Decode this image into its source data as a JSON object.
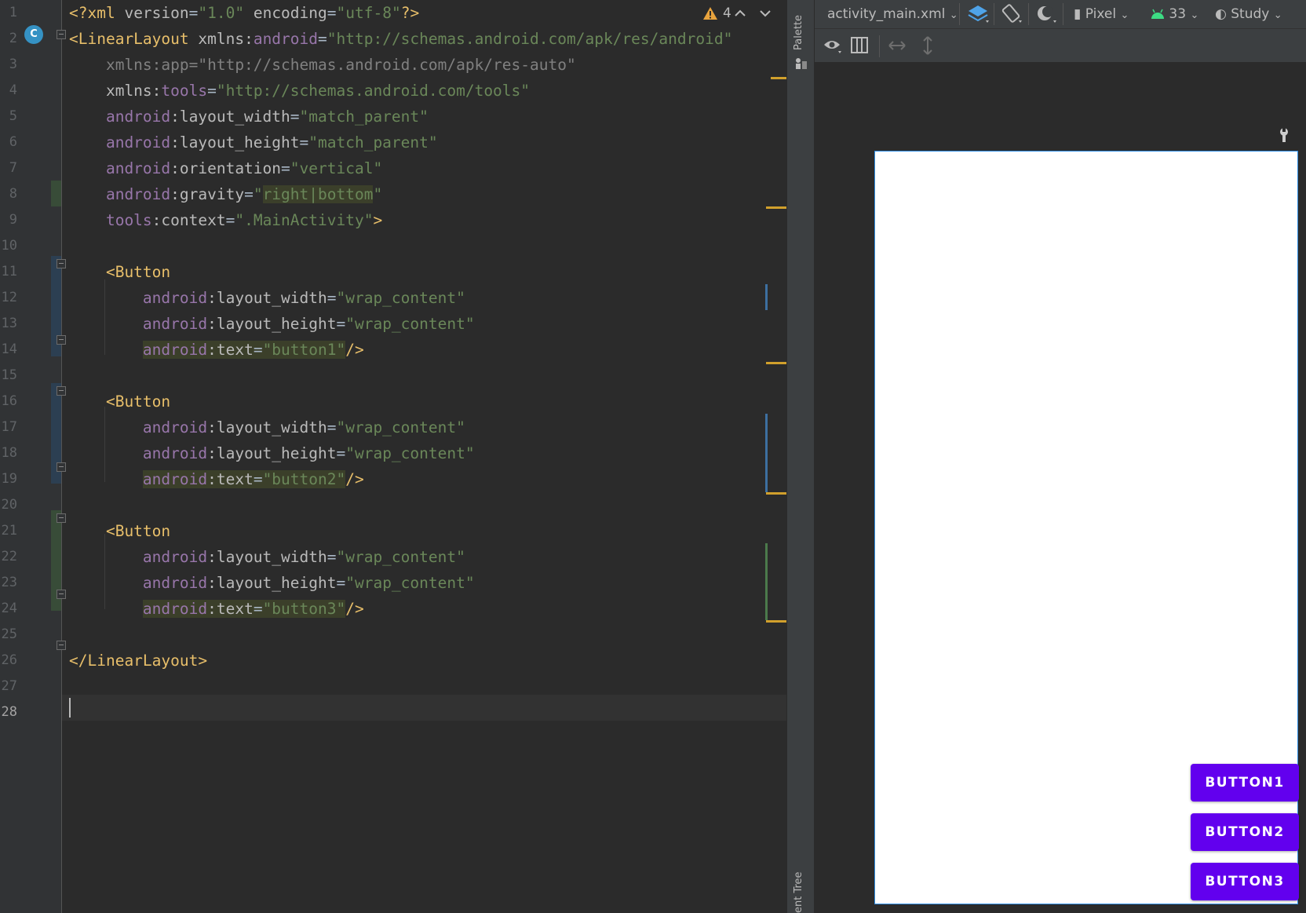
{
  "editor": {
    "line_numbers": [
      "1",
      "2",
      "3",
      "4",
      "5",
      "6",
      "7",
      "8",
      "9",
      "10",
      "11",
      "12",
      "13",
      "14",
      "15",
      "16",
      "17",
      "18",
      "19",
      "20",
      "21",
      "22",
      "23",
      "24",
      "25",
      "26",
      "27",
      "28"
    ],
    "class_badge": "C",
    "warning_count": "4",
    "lines": [
      [
        {
          "t": "<?xml ",
          "c": "c-yel"
        },
        {
          "t": "version",
          "c": "c-attr"
        },
        {
          "t": "=",
          "c": "c-pun"
        },
        {
          "t": "\"1.0\"",
          "c": "c-val"
        },
        {
          "t": " encoding",
          "c": "c-attr"
        },
        {
          "t": "=",
          "c": "c-pun"
        },
        {
          "t": "\"utf-8\"",
          "c": "c-val"
        },
        {
          "t": "?>",
          "c": "c-yel"
        }
      ],
      [
        {
          "t": "<LinearLayout ",
          "c": "c-tag"
        },
        {
          "t": "xmlns:",
          "c": "c-attr"
        },
        {
          "t": "android",
          "c": "c-ns"
        },
        {
          "t": "=",
          "c": "c-pun"
        },
        {
          "t": "\"http://schemas.android.com/apk/res/android\"",
          "c": "c-val"
        }
      ],
      [
        {
          "t": "    xmlns:app=\"http://schemas.android.com/apk/res-auto\"",
          "c": "c-gray"
        }
      ],
      [
        {
          "t": "    xmlns:",
          "c": "c-attr"
        },
        {
          "t": "tools",
          "c": "c-ns"
        },
        {
          "t": "=",
          "c": "c-pun"
        },
        {
          "t": "\"http://schemas.android.com/tools\"",
          "c": "c-val"
        }
      ],
      [
        {
          "t": "    android",
          "c": "c-ns"
        },
        {
          "t": ":layout_width",
          "c": "c-attr"
        },
        {
          "t": "=",
          "c": "c-pun"
        },
        {
          "t": "\"match_parent\"",
          "c": "c-val"
        }
      ],
      [
        {
          "t": "    android",
          "c": "c-ns"
        },
        {
          "t": ":layout_height",
          "c": "c-attr"
        },
        {
          "t": "=",
          "c": "c-pun"
        },
        {
          "t": "\"match_parent\"",
          "c": "c-val"
        }
      ],
      [
        {
          "t": "    android",
          "c": "c-ns"
        },
        {
          "t": ":orientation",
          "c": "c-attr"
        },
        {
          "t": "=",
          "c": "c-pun"
        },
        {
          "t": "\"vertical\"",
          "c": "c-val"
        }
      ],
      [
        {
          "t": "    android",
          "c": "c-ns"
        },
        {
          "t": ":gravity",
          "c": "c-attr"
        },
        {
          "t": "=",
          "c": "c-pun"
        },
        {
          "t": "\"",
          "c": "c-val"
        },
        {
          "t": "right|bottom",
          "c": "c-val hl"
        },
        {
          "t": "\"",
          "c": "c-val"
        }
      ],
      [
        {
          "t": "    tools",
          "c": "c-ns"
        },
        {
          "t": ":context",
          "c": "c-attr"
        },
        {
          "t": "=",
          "c": "c-pun"
        },
        {
          "t": "\".MainActivity\"",
          "c": "c-val"
        },
        {
          "t": ">",
          "c": "c-tag"
        }
      ],
      [],
      [
        {
          "t": "    <Button",
          "c": "c-tag"
        }
      ],
      [
        {
          "t": "        android",
          "c": "c-ns"
        },
        {
          "t": ":layout_width",
          "c": "c-attr"
        },
        {
          "t": "=",
          "c": "c-pun"
        },
        {
          "t": "\"wrap_content\"",
          "c": "c-val"
        }
      ],
      [
        {
          "t": "        android",
          "c": "c-ns"
        },
        {
          "t": ":layout_height",
          "c": "c-attr"
        },
        {
          "t": "=",
          "c": "c-pun"
        },
        {
          "t": "\"wrap_content\"",
          "c": "c-val"
        }
      ],
      [
        {
          "t": "        ",
          "c": "c-pun"
        },
        {
          "t": "android",
          "c": "c-ns hl"
        },
        {
          "t": ":text",
          "c": "c-attr hl"
        },
        {
          "t": "=",
          "c": "c-pun hl"
        },
        {
          "t": "\"button1\"",
          "c": "c-val hl"
        },
        {
          "t": "/>",
          "c": "c-tag"
        }
      ],
      [],
      [
        {
          "t": "    <Button",
          "c": "c-tag"
        }
      ],
      [
        {
          "t": "        android",
          "c": "c-ns"
        },
        {
          "t": ":layout_width",
          "c": "c-attr"
        },
        {
          "t": "=",
          "c": "c-pun"
        },
        {
          "t": "\"wrap_content\"",
          "c": "c-val"
        }
      ],
      [
        {
          "t": "        android",
          "c": "c-ns"
        },
        {
          "t": ":layout_height",
          "c": "c-attr"
        },
        {
          "t": "=",
          "c": "c-pun"
        },
        {
          "t": "\"wrap_content\"",
          "c": "c-val"
        }
      ],
      [
        {
          "t": "        ",
          "c": "c-pun"
        },
        {
          "t": "android",
          "c": "c-ns hl"
        },
        {
          "t": ":text",
          "c": "c-attr hl"
        },
        {
          "t": "=",
          "c": "c-pun hl"
        },
        {
          "t": "\"button2\"",
          "c": "c-val hl"
        },
        {
          "t": "/>",
          "c": "c-tag"
        }
      ],
      [],
      [
        {
          "t": "    <Button",
          "c": "c-tag"
        }
      ],
      [
        {
          "t": "        android",
          "c": "c-ns"
        },
        {
          "t": ":layout_width",
          "c": "c-attr"
        },
        {
          "t": "=",
          "c": "c-pun"
        },
        {
          "t": "\"wrap_content\"",
          "c": "c-val"
        }
      ],
      [
        {
          "t": "        android",
          "c": "c-ns"
        },
        {
          "t": ":layout_height",
          "c": "c-attr"
        },
        {
          "t": "=",
          "c": "c-pun"
        },
        {
          "t": "\"wrap_content\"",
          "c": "c-val"
        }
      ],
      [
        {
          "t": "        ",
          "c": "c-pun"
        },
        {
          "t": "android",
          "c": "c-ns hl"
        },
        {
          "t": ":text",
          "c": "c-attr hl"
        },
        {
          "t": "=",
          "c": "c-pun hl"
        },
        {
          "t": "\"button3\"",
          "c": "c-val hl"
        },
        {
          "t": "/>",
          "c": "c-tag"
        }
      ],
      [],
      [
        {
          "t": "</LinearLayout>",
          "c": "c-tag"
        }
      ],
      [],
      []
    ]
  },
  "side_strip": {
    "palette_label": "Palette",
    "component_tree_label": "ent Tree"
  },
  "designer": {
    "file_name": "activity_main.xml",
    "device": "Pixel",
    "api_level": "33",
    "theme": "Study",
    "preview_buttons": [
      "BUTTON1",
      "BUTTON2",
      "BUTTON3"
    ]
  },
  "colors": {
    "accent_button": "#6200ee",
    "selection_border": "#2f8de4",
    "warning": "#e8a33d"
  }
}
